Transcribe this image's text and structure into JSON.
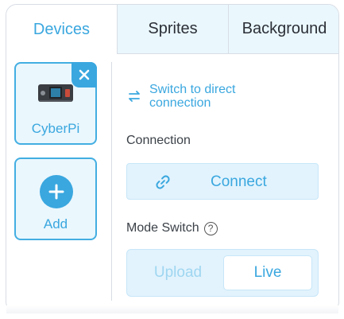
{
  "tabs": [
    {
      "label": "Devices",
      "active": true
    },
    {
      "label": "Sprites",
      "active": false
    },
    {
      "label": "Background",
      "active": false
    }
  ],
  "devices": [
    {
      "name": "CyberPi",
      "icon": "cyberpi-board-icon",
      "selected": true
    }
  ],
  "add_device": {
    "label": "Add",
    "icon": "plus-icon"
  },
  "switch_link": {
    "label": "Switch to direct connection",
    "icon": "swap-arrows-icon"
  },
  "connection": {
    "label": "Connection",
    "button_label": "Connect",
    "icon": "link-icon"
  },
  "mode_switch": {
    "label": "Mode Switch",
    "help_icon": "question-icon",
    "options": [
      "Upload",
      "Live"
    ],
    "selected": "Live"
  },
  "colors": {
    "accent": "#3aa7df",
    "accent_bg": "#eaf7fd",
    "border": "#d8dde5"
  }
}
